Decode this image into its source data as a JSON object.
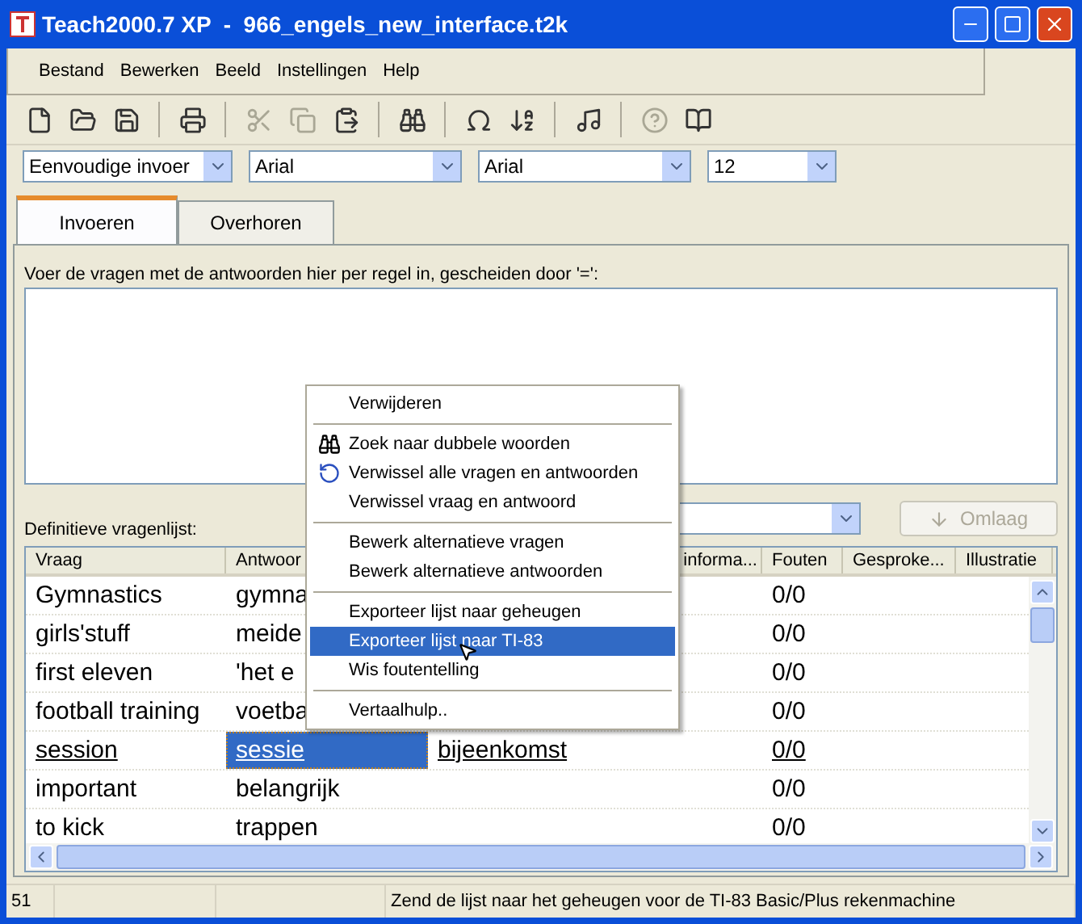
{
  "window": {
    "title": "Teach2000.7 XP  -  966_engels_new_interface.t2k"
  },
  "menu": [
    "Bestand",
    "Bewerken",
    "Beeld",
    "Instellingen",
    "Help"
  ],
  "toolbar": [
    {
      "kind": "new",
      "disabled": false
    },
    {
      "kind": "open",
      "disabled": false
    },
    {
      "kind": "save",
      "disabled": false
    },
    {
      "kind": "sep"
    },
    {
      "kind": "print",
      "disabled": false
    },
    {
      "kind": "sep"
    },
    {
      "kind": "cut",
      "disabled": true
    },
    {
      "kind": "copy",
      "disabled": true
    },
    {
      "kind": "paste",
      "disabled": false
    },
    {
      "kind": "sep"
    },
    {
      "kind": "find",
      "disabled": false
    },
    {
      "kind": "sep"
    },
    {
      "kind": "omega",
      "disabled": false
    },
    {
      "kind": "sort",
      "disabled": false
    },
    {
      "kind": "sep"
    },
    {
      "kind": "note",
      "disabled": false
    },
    {
      "kind": "sep"
    },
    {
      "kind": "help",
      "disabled": true
    },
    {
      "kind": "book",
      "disabled": false
    }
  ],
  "combos": [
    {
      "value": "Eenvoudige invoer"
    },
    {
      "value": "Arial"
    },
    {
      "value": "Arial"
    },
    {
      "value": "12"
    }
  ],
  "tabs": [
    {
      "label": "Invoeren",
      "selected": true
    },
    {
      "label": "Overhoren",
      "selected": false
    }
  ],
  "input_label": "Voer de vragen met de antwoorden hier per regel in, gescheiden door '=':",
  "list_label": "Definitieve vragenlijst:",
  "down_button": {
    "label": "Omlaag",
    "disabled": true
  },
  "table": {
    "columns": [
      "Vraag",
      "Antwoor",
      null,
      "informa...",
      "Fouten",
      "Gesproke...",
      "Illustratie"
    ],
    "rows": [
      {
        "current": false,
        "cells": [
          "Gymnastics",
          "gymna",
          null,
          null,
          "0/0"
        ]
      },
      {
        "current": false,
        "cells": [
          "girls'stuff",
          "meide",
          null,
          null,
          "0/0"
        ]
      },
      {
        "current": false,
        "cells": [
          "first eleven",
          "'het e",
          null,
          null,
          "0/0"
        ]
      },
      {
        "current": false,
        "cells": [
          "football training",
          "voetba",
          null,
          null,
          "0/0"
        ]
      },
      {
        "current": true,
        "cells": [
          "session",
          "sessie",
          "bijeenkomst",
          null,
          "0/0"
        ]
      },
      {
        "current": false,
        "cells": [
          "important",
          "belangrijk",
          null,
          null,
          "0/0"
        ]
      },
      {
        "current": false,
        "cells": [
          "to kick",
          "trappen",
          null,
          null,
          "0/0"
        ]
      }
    ]
  },
  "context_menu": [
    {
      "kind": "plain",
      "label": "Verwijderen",
      "selected": false
    },
    {
      "kind": "separator"
    },
    {
      "kind": "find",
      "label": "Zoek naar dubbele woorden",
      "selected": false
    },
    {
      "kind": "swap",
      "label": "Verwissel alle vragen en antwoorden",
      "selected": false
    },
    {
      "kind": "plain",
      "label": "Verwissel vraag en antwoord",
      "selected": false
    },
    {
      "kind": "separator"
    },
    {
      "kind": "plain",
      "label": "Bewerk alternatieve vragen",
      "selected": false
    },
    {
      "kind": "plain",
      "label": "Bewerk alternatieve antwoorden",
      "selected": false
    },
    {
      "kind": "separator"
    },
    {
      "kind": "plain",
      "label": "Exporteer lijst naar geheugen",
      "selected": false
    },
    {
      "kind": "plain",
      "label": "Exporteer lijst naar TI-83",
      "selected": true
    },
    {
      "kind": "plain",
      "label": "Wis foutentelling",
      "selected": false
    },
    {
      "kind": "separator"
    },
    {
      "kind": "plain",
      "label": "Vertaalhulp..",
      "selected": false
    }
  ],
  "status_bar": {
    "count": "51",
    "message": "Zend de lijst naar het geheugen voor de TI-83 Basic/Plus rekenmachine"
  }
}
